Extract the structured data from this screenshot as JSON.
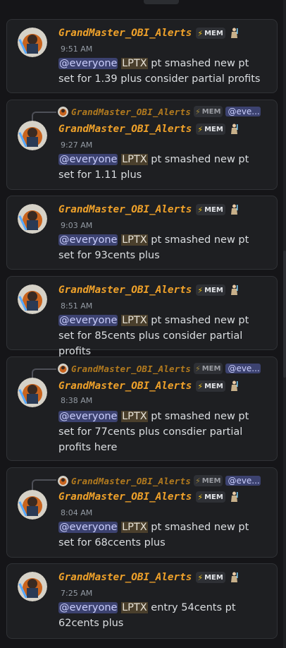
{
  "messages": [
    {
      "reply": null,
      "author": "GrandMaster_OBI_Alerts",
      "tag": "MEM",
      "time": "9:51 AM",
      "mention": "@everyone",
      "ticker": "LPTX",
      "text": " pt smashed new pt set for 1.39 plus consider partial profits"
    },
    {
      "reply": {
        "author": "GrandMaster_OBI_Alerts",
        "tag": "MEM",
        "mention": "@eve..."
      },
      "author": "GrandMaster_OBI_Alerts",
      "tag": "MEM",
      "time": "9:27 AM",
      "mention": "@everyone",
      "ticker": "LPTX",
      "text": " pt smashed new pt set for 1.11 plus"
    },
    {
      "reply": null,
      "author": "GrandMaster_OBI_Alerts",
      "tag": "MEM",
      "time": "9:03 AM",
      "mention": "@everyone",
      "ticker": "LPTX",
      "text": " pt smashed new pt set for 93cents plus"
    },
    {
      "reply": null,
      "author": "GrandMaster_OBI_Alerts",
      "tag": "MEM",
      "time": "8:51 AM",
      "mention": "@everyone",
      "ticker": "LPTX",
      "text": " pt smashed new pt set for 85cents plus consider partial profits"
    },
    {
      "reply": {
        "author": "GrandMaster_OBI_Alerts",
        "tag": "MEM",
        "mention": "@eve..."
      },
      "author": "GrandMaster_OBI_Alerts",
      "tag": "MEM",
      "time": "8:38 AM",
      "mention": "@everyone",
      "ticker": "LPTX",
      "text": " pt smashed new pt set for 77cents plus consdier partial profits here"
    },
    {
      "reply": {
        "author": "GrandMaster_OBI_Alerts",
        "tag": "MEM",
        "mention": "@eve..."
      },
      "author": "GrandMaster_OBI_Alerts",
      "tag": "MEM",
      "time": "8:04 AM",
      "mention": "@everyone",
      "ticker": "LPTX",
      "text": " pt smashed new pt set for 68ccents plus"
    },
    {
      "reply": null,
      "author": "GrandMaster_OBI_Alerts",
      "tag": "MEM",
      "time": "7:25 AM",
      "mention": "@everyone",
      "ticker": "LPTX",
      "text": " entry 54cents pt 62cents plus"
    }
  ],
  "colors": {
    "background": "#151518",
    "card": "#1e1f22",
    "author": "#f0a22a",
    "mention_bg": "#3c4270",
    "ticker_bg": "#4a3f2c"
  },
  "icons": {
    "tag": "lightning-bolt-icon",
    "badge": "jedi-figure-icon",
    "avatar": "lightsaber-portrait-avatar"
  }
}
